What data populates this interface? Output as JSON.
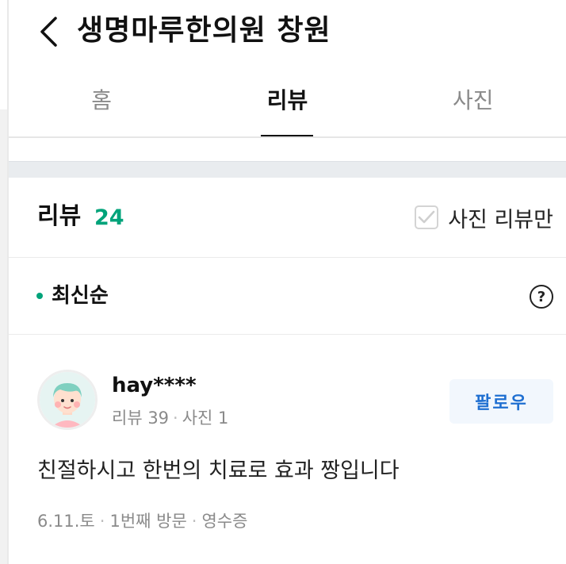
{
  "header": {
    "title": "생명마루한의원 창원"
  },
  "tabs": [
    {
      "label": "홈",
      "active": false
    },
    {
      "label": "리뷰",
      "active": true
    },
    {
      "label": "사진",
      "active": false
    }
  ],
  "review_section": {
    "title": "리뷰",
    "count": "24",
    "photo_only_label": "사진 리뷰만",
    "photo_only_checked": false
  },
  "sort": {
    "label": "최신순",
    "help_symbol": "?"
  },
  "review": {
    "nickname": "hay****",
    "reviews_label": "리뷰 39",
    "photos_label": "사진 1",
    "follow_label": "팔로우",
    "text": "친절하시고 한번의 치료로 효과 짱입니다",
    "date": "6.11.토",
    "visit": "1번째 방문",
    "receipt": "영수증"
  },
  "colors": {
    "accent_green": "#00a37a",
    "follow_blue": "#1f6fd1",
    "follow_bg": "#f2f7fd",
    "muted_text": "#8a8a8a"
  },
  "icons": [
    "back-arrow-icon",
    "checkmark-icon",
    "question-icon",
    "avatar-illustration"
  ]
}
